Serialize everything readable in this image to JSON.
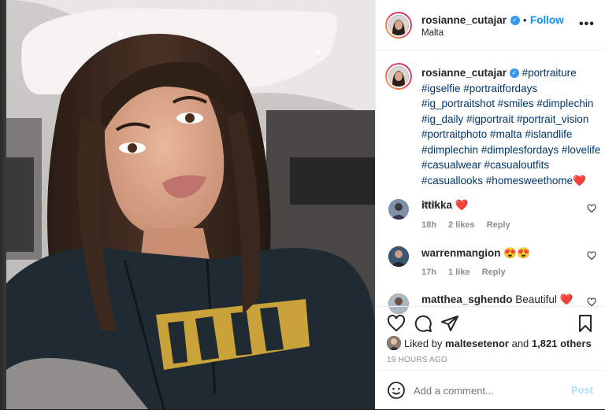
{
  "post": {
    "username": "rosianne_cutajar",
    "follow_label": "Follow",
    "separator": "•",
    "location": "Malta",
    "more_label": "•••",
    "caption_tags": "#portraiture #igselfie #portraitfordays #ig_portraitshot #smiles #dimplechin #ig_daily #igportrait #portrait_vision #portraitphoto #malta #islandlife #dimplechin #dimplesfordays #lovelife #casualwear #casualoutfits #casuallooks #homesweethome❤️",
    "caption_time": "19h",
    "verified_glyph": "✓"
  },
  "comments": [
    {
      "user": "ittikka",
      "text": "❤️",
      "time": "18h",
      "likes": "2 likes",
      "reply": "Reply"
    },
    {
      "user": "warrenmangion",
      "text": "😍😍",
      "time": "17h",
      "likes": "1 like",
      "reply": "Reply"
    },
    {
      "user": "matthea_sghendo",
      "text": "Beautiful ❤️"
    }
  ],
  "likes": {
    "prefix": "Liked by",
    "user": "maltesetenor",
    "and": "and",
    "count": "1,821 others"
  },
  "timestamp": "19 HOURS AGO",
  "comment_box": {
    "placeholder": "Add a comment...",
    "post_label": "Post"
  },
  "colors": {
    "link": "#0095f6",
    "hashtag": "#00376b",
    "heart": "#ed4956"
  },
  "icons": [
    "heart-icon",
    "comment-icon",
    "share-icon",
    "bookmark-icon",
    "emoji-icon",
    "more-options-icon",
    "verified-badge-icon"
  ]
}
